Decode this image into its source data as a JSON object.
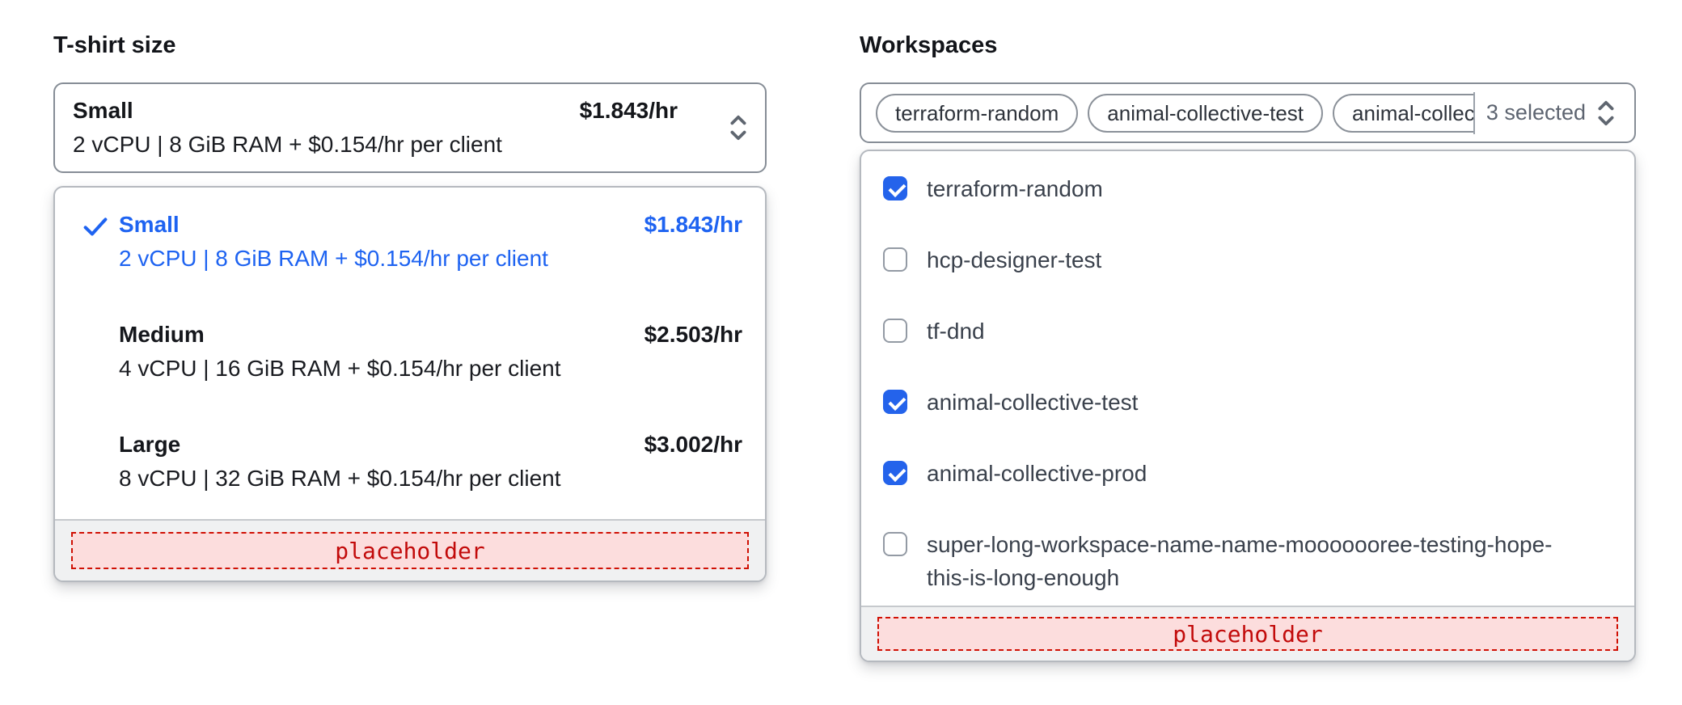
{
  "tshirt": {
    "label": "T-shirt size",
    "trigger": {
      "name": "Small",
      "desc": "2 vCPU | 8 GiB RAM + $0.154/hr per client",
      "price": "$1.843/hr"
    },
    "options": [
      {
        "name": "Small",
        "desc": "2 vCPU | 8 GiB RAM + $0.154/hr per client",
        "price": "$1.843/hr",
        "selected": true
      },
      {
        "name": "Medium",
        "desc": "4 vCPU | 16 GiB RAM + $0.154/hr per client",
        "price": "$2.503/hr",
        "selected": false
      },
      {
        "name": "Large",
        "desc": "8 vCPU | 32 GiB RAM + $0.154/hr per client",
        "price": "$3.002/hr",
        "selected": false
      }
    ],
    "footer_placeholder": "placeholder"
  },
  "workspaces": {
    "label": "Workspaces",
    "selected_tags": [
      "terraform-random",
      "animal-collective-test",
      "animal-collective-prod"
    ],
    "count_label": "3 selected",
    "options": [
      {
        "label": "terraform-random",
        "checked": true
      },
      {
        "label": "hcp-designer-test",
        "checked": false
      },
      {
        "label": "tf-dnd",
        "checked": false
      },
      {
        "label": "animal-collective-test",
        "checked": true
      },
      {
        "label": "animal-collective-prod",
        "checked": true
      },
      {
        "label": "super-long-workspace-name-name-mooooooree-testing-hope-this-is-long-enough",
        "checked": false
      }
    ],
    "footer_placeholder": "placeholder"
  },
  "colors": {
    "accent_text_blue": "#1e63f1",
    "checkbox_blue": "#2463eb",
    "placeholder_red": "#c20a0a",
    "placeholder_bg": "#fcdddd",
    "footer_gray": "#f0f1f2"
  }
}
